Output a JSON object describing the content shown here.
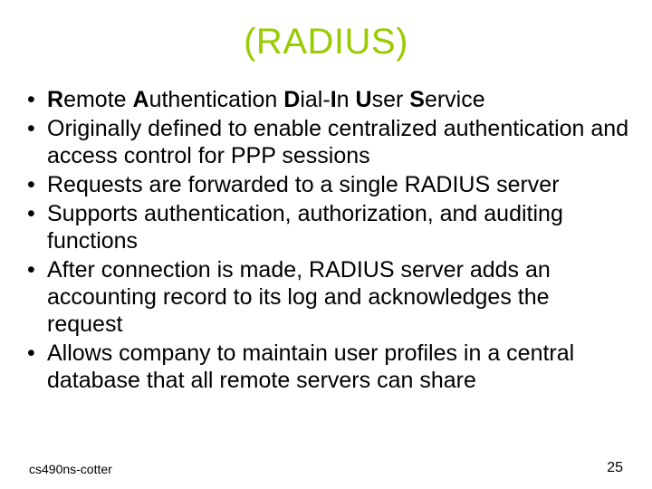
{
  "title": "(RADIUS)",
  "acronym": {
    "r": "R",
    "r_rest": "emote ",
    "a": "A",
    "a_rest": "uthentication ",
    "d": "D",
    "d_rest": "ial-",
    "i": "I",
    "i_rest": "n ",
    "u": "U",
    "u_rest": "ser ",
    "s": "S",
    "s_rest": "ervice"
  },
  "bullets": {
    "b2": "Originally defined to enable centralized authentication and access control for PPP sessions",
    "b3": "Requests are forwarded to a single RADIUS server",
    "b4": "Supports authentication, authorization, and auditing functions",
    "b5": "After connection is made, RADIUS server adds an accounting record to its log and acknowledges the request",
    "b6": "Allows company to maintain user profiles in a central database that all remote servers can share"
  },
  "footer": {
    "left": "cs490ns-cotter",
    "right": "25"
  }
}
